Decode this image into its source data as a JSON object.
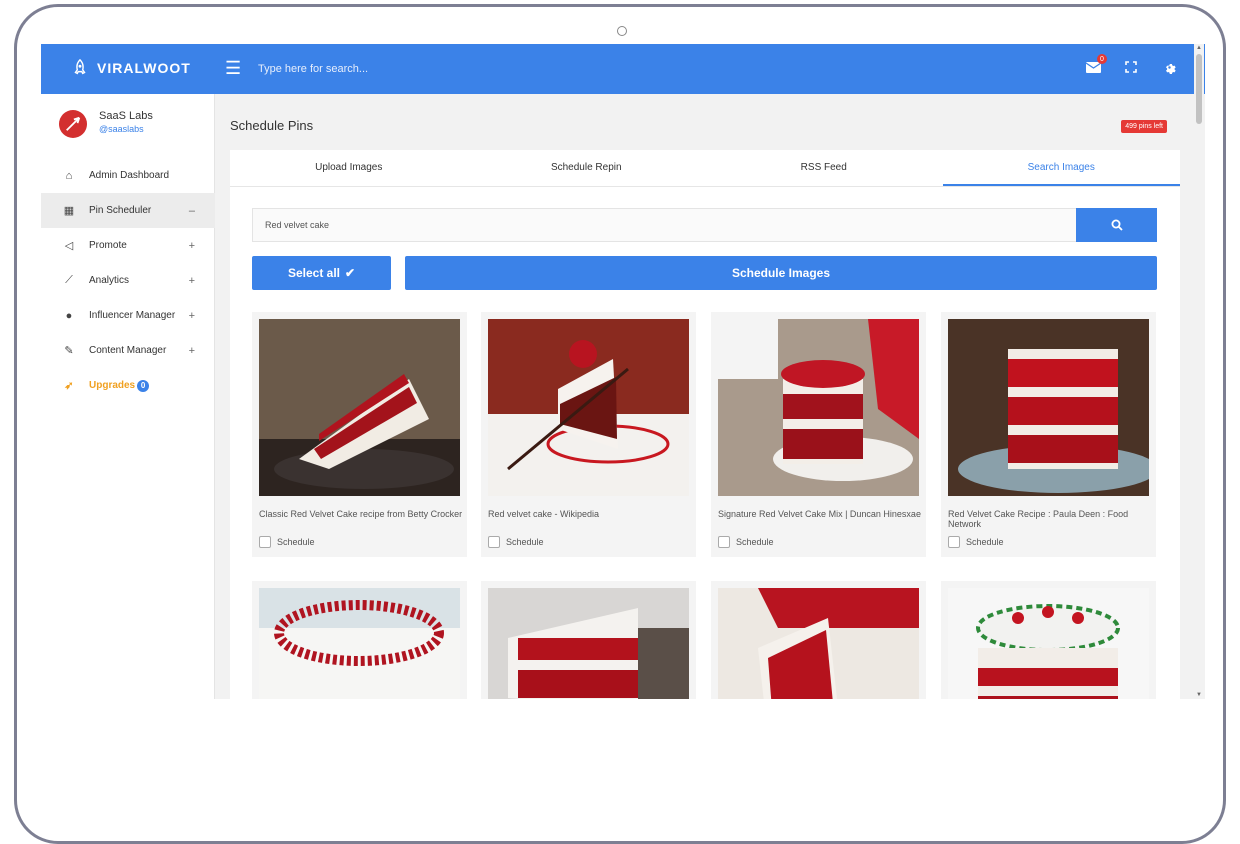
{
  "app": {
    "brand": "VIRALWOOT",
    "search_placeholder": "Type here for search...",
    "notif_count": "0"
  },
  "colors": {
    "accent": "#3b82e8",
    "danger": "#e53935",
    "upgrade": "#f0a020"
  },
  "profile": {
    "name": "SaaS Labs",
    "handle": "@saaslabs"
  },
  "sidebar": {
    "items": [
      {
        "label": "Admin Dashboard",
        "icon": "home-icon",
        "toggle": ""
      },
      {
        "label": "Pin Scheduler",
        "icon": "calendar-icon",
        "toggle": "–"
      },
      {
        "label": "Promote",
        "icon": "megaphone-icon",
        "toggle": "+"
      },
      {
        "label": "Analytics",
        "icon": "chart-icon",
        "toggle": "+"
      },
      {
        "label": "Influencer Manager",
        "icon": "users-icon",
        "toggle": "+"
      },
      {
        "label": "Content Manager",
        "icon": "edit-icon",
        "toggle": "+"
      },
      {
        "label": "Upgrades",
        "icon": "rocket-icon",
        "badge": "0"
      }
    ]
  },
  "main": {
    "title": "Schedule Pins",
    "pins_left": "499 pins left",
    "tabs": [
      "Upload Images",
      "Schedule Repin",
      "RSS Feed",
      "Search Images"
    ],
    "search_value": "Red velvet cake",
    "select_all": "Select all",
    "schedule_images": "Schedule Images",
    "schedule_label": "Schedule",
    "cards": [
      {
        "title": "Classic Red Velvet Cake recipe from Betty Crocker"
      },
      {
        "title": "Red velvet cake - Wikipedia"
      },
      {
        "title": "Signature Red Velvet Cake Mix | Duncan Hinesxae"
      },
      {
        "title": "Red Velvet Cake Recipe : Paula Deen : Food Network"
      },
      {
        "title": ""
      },
      {
        "title": ""
      },
      {
        "title": ""
      },
      {
        "title": ""
      }
    ]
  }
}
